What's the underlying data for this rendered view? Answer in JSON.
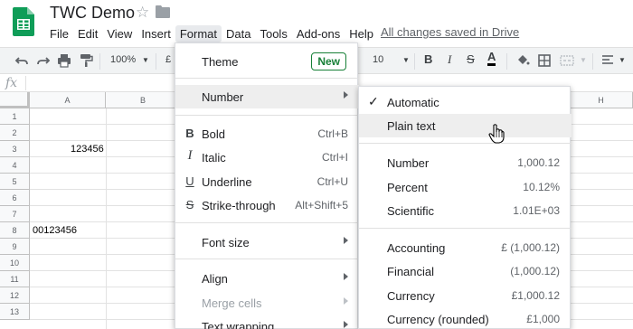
{
  "app": {
    "title": "TWC Demo",
    "save_status": "All changes saved in Drive"
  },
  "menubar": [
    "File",
    "Edit",
    "View",
    "Insert",
    "Format",
    "Data",
    "Tools",
    "Add-ons",
    "Help"
  ],
  "toolbar": {
    "zoom": "100%",
    "currency": "£",
    "font_size": "10",
    "bold": "B",
    "italic": "I",
    "strikethrough": "S",
    "text_color": "A"
  },
  "formula_bar": {
    "fx": "fx"
  },
  "grid": {
    "columns": [
      "A",
      "B",
      "H"
    ],
    "rows": [
      "1",
      "2",
      "3",
      "4",
      "5",
      "6",
      "7",
      "8",
      "9",
      "10",
      "11",
      "12",
      "13"
    ],
    "cells": {
      "A3": "123456",
      "A8": "00123456"
    }
  },
  "format_menu": {
    "theme": "Theme",
    "new_badge": "New",
    "number": "Number",
    "bold": "Bold",
    "bold_shortcut": "Ctrl+B",
    "italic": "Italic",
    "italic_shortcut": "Ctrl+I",
    "underline": "Underline",
    "underline_shortcut": "Ctrl+U",
    "strikethrough": "Strike-through",
    "strikethrough_shortcut": "Alt+Shift+5",
    "font_size": "Font size",
    "align": "Align",
    "merge_cells": "Merge cells",
    "text_wrapping": "Text wrapping"
  },
  "number_submenu": {
    "automatic": "Automatic",
    "plain_text": "Plain text",
    "number": "Number",
    "number_example": "1,000.12",
    "percent": "Percent",
    "percent_example": "10.12%",
    "scientific": "Scientific",
    "scientific_example": "1.01E+03",
    "accounting": "Accounting",
    "accounting_example": "£ (1,000.12)",
    "financial": "Financial",
    "financial_example": "(1,000.12)",
    "currency": "Currency",
    "currency_example": "£1,000.12",
    "currency_rounded": "Currency (rounded)",
    "currency_rounded_example": "£1,000"
  },
  "colors": {
    "brand_green": "#0f9d58",
    "new_badge_green": "#188038",
    "menu_hover": "#eeeeee"
  }
}
